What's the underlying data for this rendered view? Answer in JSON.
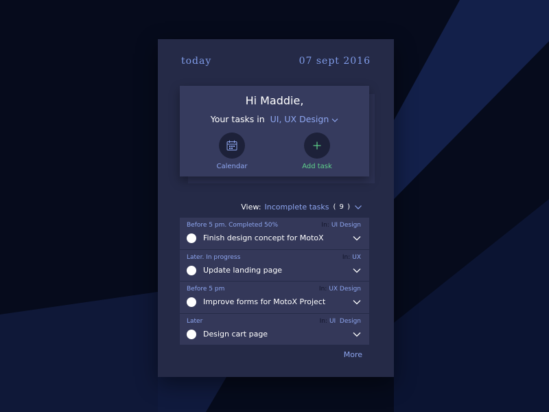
{
  "colors": {
    "background": "#060b1c",
    "card": "#252a47",
    "accent": "#8ea6f0",
    "add_accent": "#5fd18b",
    "text": "#ffffff"
  },
  "header": {
    "today_label": "today",
    "date": "07 sept 2016"
  },
  "greeting": {
    "hello": "Hi Maddie,",
    "tasks_prefix": "Your tasks in",
    "project": "UI, UX Design",
    "project_icon": "chevron-down-icon"
  },
  "actions": {
    "calendar": {
      "label": "Calendar",
      "icon": "calendar-icon"
    },
    "add": {
      "label": "Add task",
      "icon": "plus-icon"
    }
  },
  "view": {
    "prefix": "View:",
    "filter": "Incomplete tasks",
    "count": "( 9 )"
  },
  "tasks": [
    {
      "when": "Before 5 pm. Completed 50%",
      "in_label": "In:",
      "category": "UI Design",
      "title": "Finish design concept for MotoX"
    },
    {
      "when": "Later. In progress",
      "in_label": "In:",
      "category": "UX",
      "title": "Update landing page"
    },
    {
      "when": "Before 5 pm",
      "in_label": "In:",
      "category": "UX Design",
      "title": "Improve forms for MotoX Project"
    },
    {
      "when": "Later",
      "in_label": "In:",
      "category": "UI  Design",
      "title": "Design cart page"
    }
  ],
  "more_label": "More"
}
